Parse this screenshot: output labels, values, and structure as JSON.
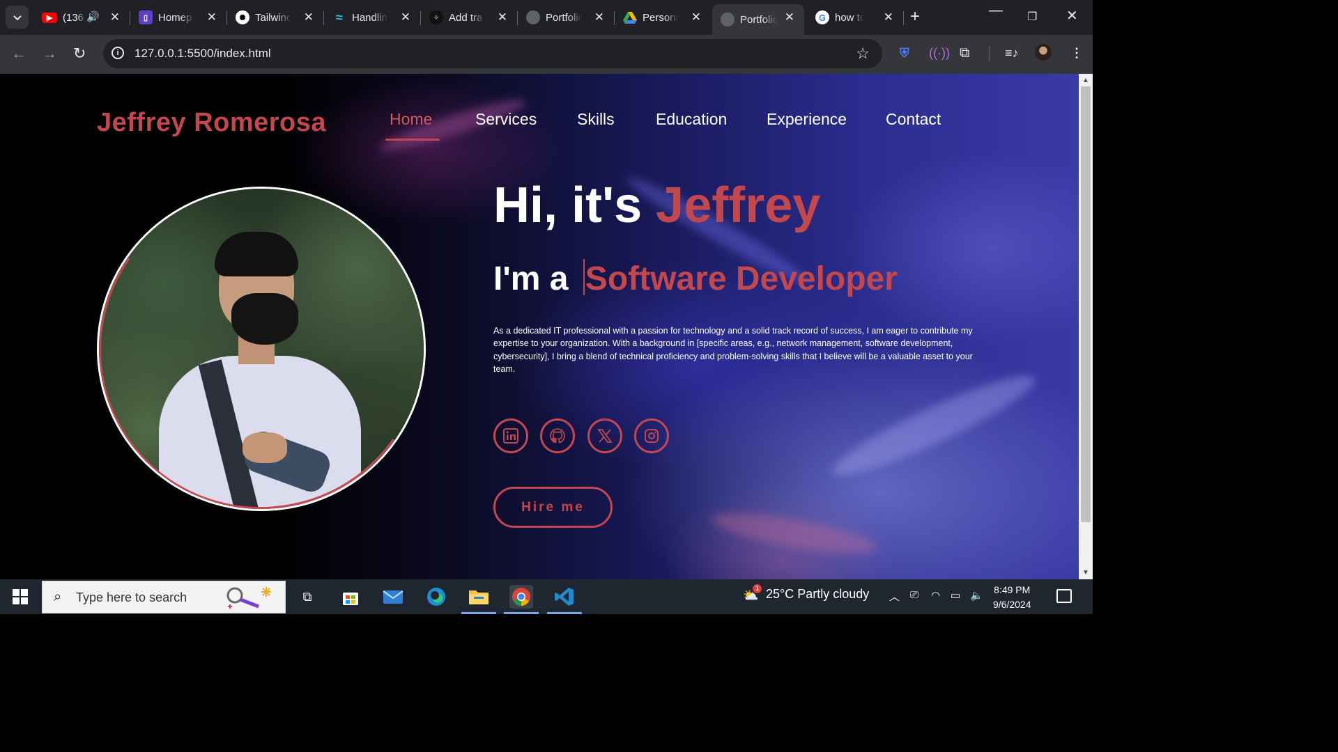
{
  "browser": {
    "tabs": [
      {
        "label": "(136",
        "fav": "youtube-icon",
        "fav_color": "#ff0000",
        "audio": true
      },
      {
        "label": "Homep",
        "fav": "homepage-icon",
        "fav_color": "#5b3fc4"
      },
      {
        "label": "Tailwind",
        "fav": "chatgpt-icon",
        "fav_color": "#ffffff"
      },
      {
        "label": "Handlin",
        "fav": "tailwind-icon",
        "fav_color": "#38bdf8"
      },
      {
        "label": "Add tra",
        "fav": "dots-icon",
        "fav_color": "#111111"
      },
      {
        "label": "Portfolic",
        "fav": "globe-icon",
        "fav_color": "#5f6368"
      },
      {
        "label": "Persona",
        "fav": "drive-icon",
        "fav_color": "#fbbc04"
      },
      {
        "label": "Portfolic",
        "fav": "globe-icon",
        "fav_color": "#5f6368",
        "active": true
      },
      {
        "label": "how to",
        "fav": "google-icon",
        "fav_color": "#4285f4"
      }
    ],
    "url": "127.0.0.1:5500/index.html"
  },
  "site": {
    "logo": "Jeffrey Romerosa",
    "nav": [
      "Home",
      "Services",
      "Skills",
      "Education",
      "Experience",
      "Contact"
    ],
    "active_nav": "Home",
    "hero": {
      "greeting": "Hi, it's ",
      "name": "Jeffrey",
      "role_prefix": "I'm a ",
      "role": "Software Developer",
      "bio": "As a dedicated IT professional with a passion for technology and a solid track record of success, I am eager to contribute my expertise to your organization. With a background in [specific areas, e.g., network management, software development, cybersecurity], I bring a blend of technical proficiency and problem-solving skills that I believe will be a valuable asset to your team.",
      "socials": [
        "linkedin-icon",
        "github-icon",
        "x-icon",
        "instagram-icon"
      ],
      "cta": "Hire me"
    },
    "colors": {
      "accent": "#c2484e",
      "text": "#ffffff"
    }
  },
  "taskbar": {
    "search_placeholder": "Type here to search",
    "weather": "25°C  Partly cloudy",
    "weather_badge": "1",
    "time": "8:49 PM",
    "date": "9/6/2024"
  }
}
